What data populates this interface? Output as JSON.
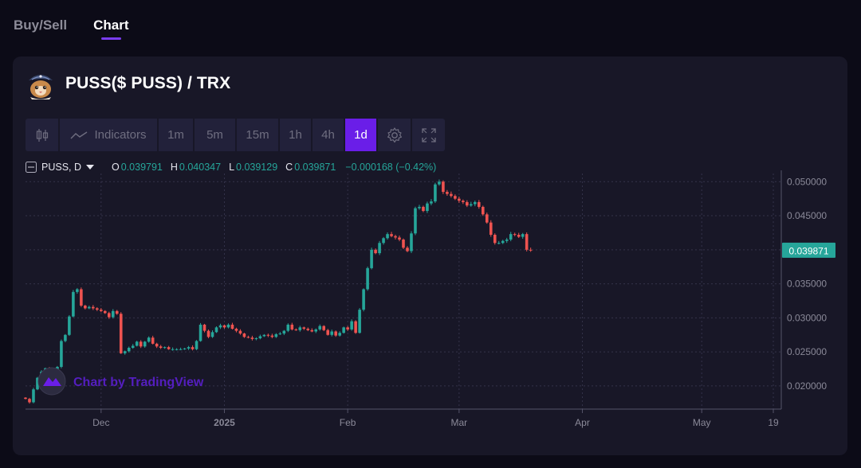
{
  "tabs": [
    {
      "label": "Buy/Sell",
      "active": false
    },
    {
      "label": "Chart",
      "active": true
    }
  ],
  "pair": {
    "title": "PUSS($ PUSS) / TRX",
    "logo_icon": "cat-pirate-logo"
  },
  "toolbar": {
    "candle_icon": "candlestick-icon",
    "indicators_label": "Indicators",
    "intervals": [
      "1m",
      "5m",
      "15m",
      "1h",
      "4h",
      "1d"
    ],
    "active_interval": "1d",
    "settings_icon": "gear-icon",
    "fullscreen_icon": "fullscreen-icon"
  },
  "legend": {
    "symbol": "PUSS, D",
    "o_label": "O",
    "o": "0.039791",
    "h_label": "H",
    "h": "0.040347",
    "l_label": "L",
    "l": "0.039129",
    "c_label": "C",
    "c": "0.039871",
    "change": "−0.000168 (−0.42%)"
  },
  "watermark": "Chart by TradingView",
  "price_badge": "0.039871",
  "colors": {
    "up": "#26a69a",
    "down": "#ef5350",
    "accent": "#6a1ee8",
    "badge": "#26a69a"
  },
  "chart_data": {
    "type": "candlestick",
    "title": "PUSS($ PUSS) / TRX",
    "interval": "1d",
    "y_ticks": [
      "0.020000",
      "0.025000",
      "0.030000",
      "0.035000",
      "0.040000",
      "0.045000",
      "0.050000"
    ],
    "y_range": [
      0.0166,
      0.0512
    ],
    "x_ticks": [
      {
        "label": "Dec",
        "date": "2024-12-01",
        "bold": false
      },
      {
        "label": "2025",
        "date": "2025-01-01",
        "bold": true
      },
      {
        "label": "Feb",
        "date": "2025-02-01",
        "bold": false
      },
      {
        "label": "Mar",
        "date": "2025-03-01",
        "bold": false
      },
      {
        "label": "Apr",
        "date": "2025-04-01",
        "bold": false
      },
      {
        "label": "May",
        "date": "2025-05-01",
        "bold": false
      },
      {
        "label": "19",
        "date": "2025-05-19",
        "bold": false
      }
    ],
    "x_range": [
      "2024-11-12",
      "2025-05-21"
    ],
    "first_date": "2024-11-12",
    "ohlc_close": [
      0.0181,
      0.0176,
      0.0195,
      0.0212,
      0.0221,
      0.0226,
      0.0222,
      0.0224,
      0.0228,
      0.0266,
      0.0275,
      0.0302,
      0.0338,
      0.0342,
      0.0318,
      0.0314,
      0.0316,
      0.0314,
      0.0312,
      0.031,
      0.0307,
      0.0301,
      0.031,
      0.0306,
      0.0248,
      0.0251,
      0.0256,
      0.0259,
      0.0265,
      0.0258,
      0.0265,
      0.0271,
      0.0262,
      0.0258,
      0.0256,
      0.0257,
      0.0254,
      0.0254,
      0.0254,
      0.0254,
      0.0255,
      0.0257,
      0.0254,
      0.0266,
      0.029,
      0.0281,
      0.0272,
      0.0279,
      0.0286,
      0.0289,
      0.0286,
      0.029,
      0.0284,
      0.0281,
      0.0277,
      0.0272,
      0.0271,
      0.0269,
      0.027,
      0.0273,
      0.0275,
      0.0274,
      0.0272,
      0.0276,
      0.0277,
      0.0281,
      0.029,
      0.0283,
      0.0282,
      0.0286,
      0.0284,
      0.0282,
      0.028,
      0.0283,
      0.0288,
      0.0282,
      0.0275,
      0.028,
      0.0274,
      0.0278,
      0.0286,
      0.0283,
      0.0295,
      0.0278,
      0.0312,
      0.0342,
      0.0373,
      0.04,
      0.0395,
      0.041,
      0.0417,
      0.0423,
      0.042,
      0.0418,
      0.0415,
      0.0403,
      0.0398,
      0.0424,
      0.0461,
      0.0463,
      0.0457,
      0.0468,
      0.0471,
      0.0496,
      0.05,
      0.0485,
      0.0482,
      0.0479,
      0.0475,
      0.0472,
      0.047,
      0.0465,
      0.0467,
      0.047,
      0.0463,
      0.0452,
      0.044,
      0.0422,
      0.041,
      0.041,
      0.0413,
      0.0415,
      0.0423,
      0.0422,
      0.0419,
      0.0423,
      0.04,
      0.0399
    ]
  }
}
